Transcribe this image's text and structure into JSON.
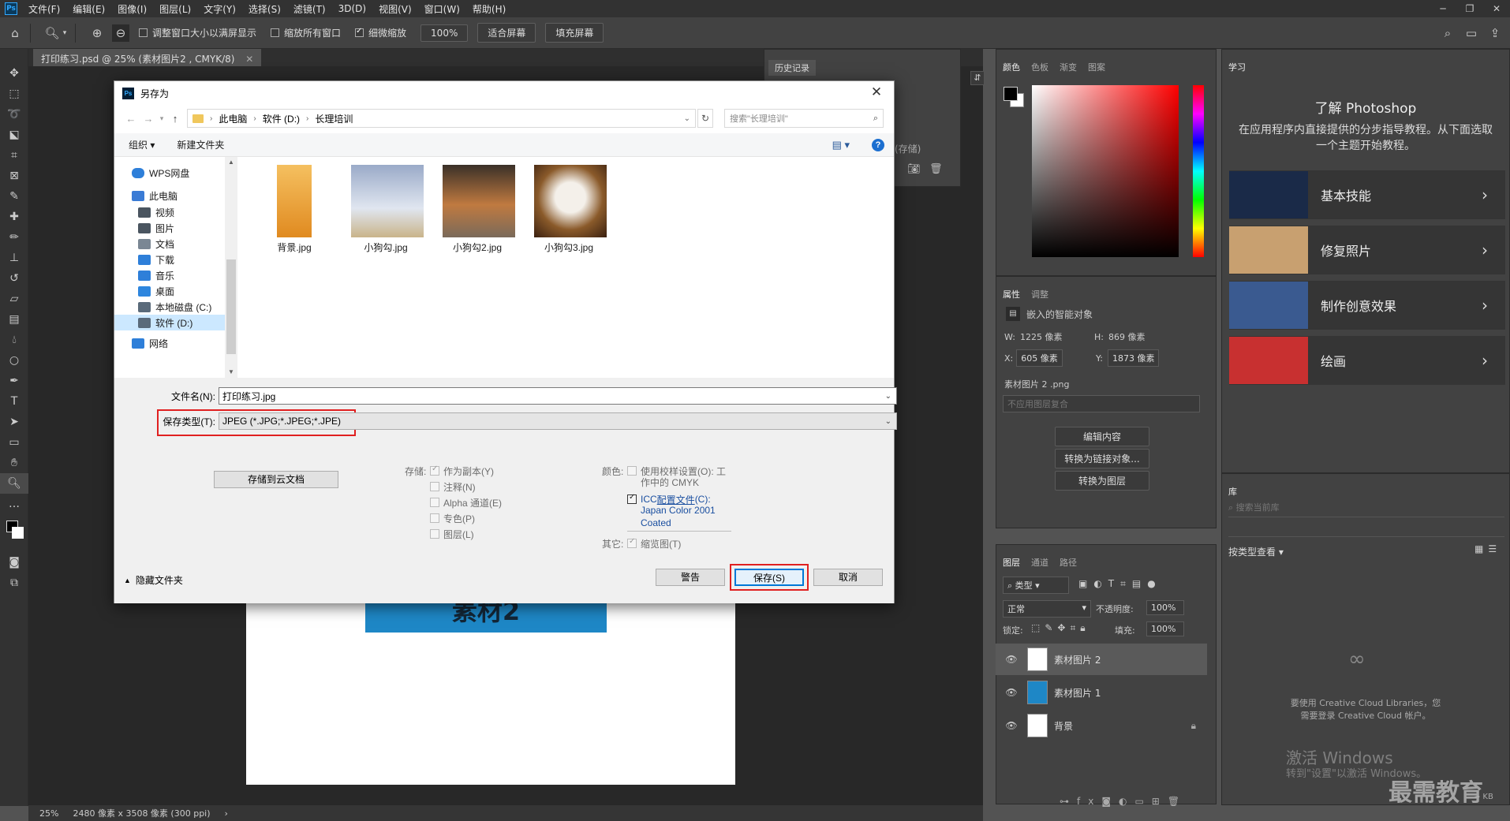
{
  "menubar": {
    "logo": "Ps",
    "items": [
      "文件(F)",
      "编辑(E)",
      "图像(I)",
      "图层(L)",
      "文字(Y)",
      "选择(S)",
      "滤镜(T)",
      "3D(D)",
      "视图(V)",
      "窗口(W)",
      "帮助(H)"
    ]
  },
  "optionsbar": {
    "resize_windows": "调整窗口大小以满屏显示",
    "zoom_all": "缩放所有窗口",
    "scrubby_zoom": "细微缩放",
    "zoom_level": "100%",
    "fit_screen": "适合屏幕",
    "fill_screen": "填充屏幕"
  },
  "document": {
    "tab_title": "打印练习.psd @ 25% (素材图片2 , CMYK/8)",
    "canvas_text": "素材2",
    "status_zoom": "25%",
    "status_info": "2480 像素 x 3508 像素 (300 ppi)"
  },
  "history": {
    "tab": "历史记录",
    "item_fragment": "(存储)"
  },
  "dialog": {
    "title": "另存为",
    "breadcrumb": [
      "此电脑",
      "软件 (D:)",
      "长理培训"
    ],
    "search_placeholder": "搜索\"长理培训\"",
    "organize": "组织 ▾",
    "new_folder": "新建文件夹",
    "nav_items": [
      {
        "label": "WPS网盘",
        "color": "#2e7fd9"
      },
      {
        "label": "此电脑",
        "color": "#3a7bd5"
      },
      {
        "label": "视频",
        "color": "#4a5560"
      },
      {
        "label": "图片",
        "color": "#4a5560"
      },
      {
        "label": "文档",
        "color": "#7a8794"
      },
      {
        "label": "下载",
        "color": "#2e7fd9"
      },
      {
        "label": "音乐",
        "color": "#2e7fd9"
      },
      {
        "label": "桌面",
        "color": "#2e86de"
      },
      {
        "label": "本地磁盘 (C:)",
        "color": "#5a6a7a"
      },
      {
        "label": "软件 (D:)",
        "color": "#5a6a7a"
      },
      {
        "label": "网络",
        "color": "#2e7fd9"
      }
    ],
    "files": [
      {
        "name": "背景.jpg",
        "color": "#e8a040"
      },
      {
        "name": "小狗勾.jpg",
        "color": "#c9b48a"
      },
      {
        "name": "小狗勾2.jpg",
        "color": "#7a6a5a"
      },
      {
        "name": "小狗勾3.jpg",
        "color": "#8a5a2a"
      }
    ],
    "filename_label": "文件名(N):",
    "filename_value": "打印练习.jpg",
    "filetype_label": "保存类型(T):",
    "filetype_value": "JPEG (*.JPG;*.JPEG;*.JPE)",
    "save_cloud": "存储到云文档",
    "storage_label": "存储:",
    "storage_options": [
      "作为副本(Y)",
      "注释(N)",
      "Alpha 通道(E)",
      "专色(P)",
      "图层(L)"
    ],
    "color_label": "颜色:",
    "proof_setup_line1": "使用校样设置(O):  工",
    "proof_setup_line2": "作中的 CMYK",
    "icc_prefix": "ICC ",
    "icc_link": "配置文件",
    "icc_suffix": "(C):",
    "icc_line2": "Japan Color 2001",
    "icc_line3": "Coated",
    "other_label": "其它:",
    "thumbnail": "缩览图(T)",
    "hide_folders": "隐藏文件夹",
    "warning": "警告",
    "save": "保存(S)",
    "cancel": "取消"
  },
  "colorpanel": {
    "tabs": [
      "颜色",
      "色板",
      "渐变",
      "图案"
    ]
  },
  "properties": {
    "tabs": [
      "属性",
      "调整"
    ],
    "type": "嵌入的智能对象",
    "w_label": "W:",
    "w_value": "1225 像素",
    "h_label": "H:",
    "h_value": "869 像素",
    "x_label": "X:",
    "x_value": "605 像素",
    "y_label": "Y:",
    "y_value": "1873 像素",
    "source": "素材图片 2 .png",
    "comp": "不应用图层复合",
    "btn_edit": "编辑内容",
    "btn_link": "转换为链接对象...",
    "btn_layers": "转换为图层"
  },
  "layers": {
    "tabs": [
      "图层",
      "通道",
      "路径"
    ],
    "filter": "类型",
    "blend": "正常",
    "opacity_label": "不透明度:",
    "opacity": "100%",
    "lock_label": "锁定:",
    "fill_label": "填充:",
    "fill": "100%",
    "items": [
      "素材图片 2",
      "素材图片 1",
      "背景"
    ]
  },
  "learn": {
    "tab": "学习",
    "title": "了解 Photoshop",
    "desc": "在应用程序内直接提供的分步指导教程。从下面选取一个主题开始教程。",
    "cards": [
      {
        "label": "基本技能",
        "color": "#1a2a48"
      },
      {
        "label": "修复照片",
        "color": "#c8a070"
      },
      {
        "label": "制作创意效果",
        "color": "#3a5a90"
      },
      {
        "label": "绘画",
        "color": "#c83030"
      }
    ]
  },
  "library": {
    "tab": "库",
    "search_placeholder": "搜索当前库",
    "view_by": "按类型查看",
    "cc_msg1": "要使用 Creative Cloud Libraries，您",
    "cc_msg2": "需要登录 Creative Cloud 帐户。",
    "footer": "-- KB"
  },
  "watermark": {
    "activate": "激活 Windows",
    "goto": "转到\"设置\"以激活 Windows。",
    "brand": "最需教育"
  }
}
